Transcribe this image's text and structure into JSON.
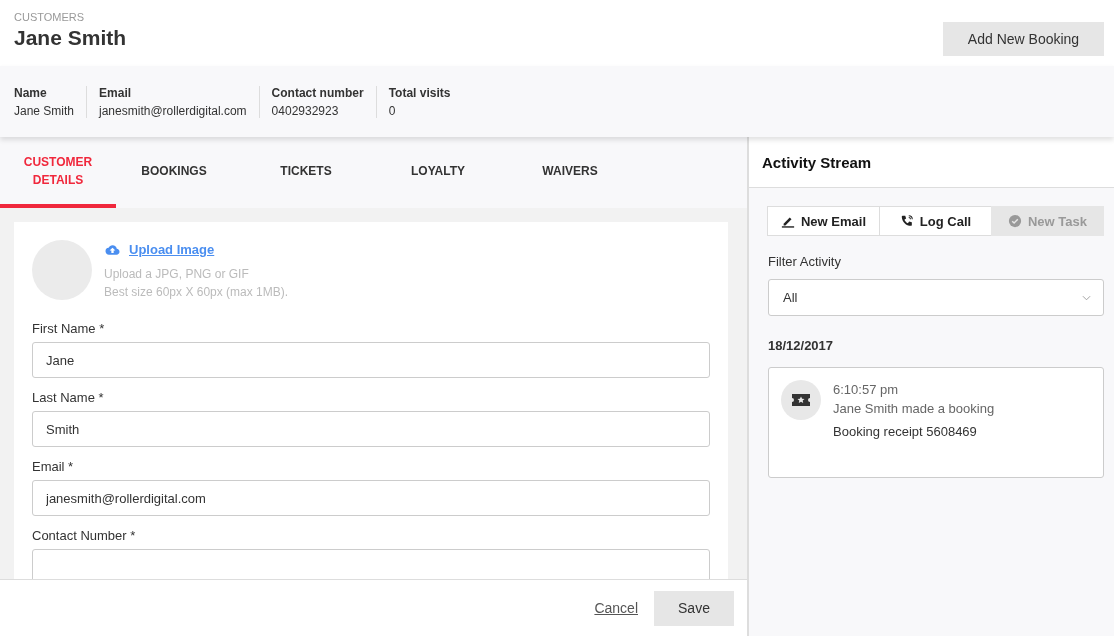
{
  "header": {
    "section": "CUSTOMERS",
    "title": "Jane Smith",
    "action": "Add New Booking"
  },
  "summary": [
    {
      "label": "Name",
      "value": "Jane Smith"
    },
    {
      "label": "Email",
      "value": "janesmith@rollerdigital.com"
    },
    {
      "label": "Contact number",
      "value": "0402932923"
    },
    {
      "label": "Total visits",
      "value": "0"
    }
  ],
  "tabs": [
    {
      "label": "CUSTOMER DETAILS",
      "selected": true
    },
    {
      "label": "BOOKINGS",
      "selected": false
    },
    {
      "label": "TICKETS",
      "selected": false
    },
    {
      "label": "LOYALTY",
      "selected": false
    },
    {
      "label": "WAIVERS",
      "selected": false
    }
  ],
  "upload": {
    "link": "Upload Image",
    "hint_1": "Upload a JPG, PNG or GIF",
    "hint_2": "Best size 60px X 60px (max 1MB)."
  },
  "fields": [
    {
      "label": "First Name *",
      "value": "Jane"
    },
    {
      "label": "Last Name *",
      "value": "Smith"
    },
    {
      "label": "Email *",
      "value": "janesmith@rollerdigital.com"
    },
    {
      "label": "Contact Number *"
    }
  ],
  "footer": {
    "cancel": "Cancel",
    "save": "Save"
  },
  "activity": {
    "title": "Activity Stream",
    "actions": [
      {
        "kind": "email",
        "label": "New Email",
        "disabled": false
      },
      {
        "kind": "call",
        "label": "Log Call",
        "disabled": false
      },
      {
        "kind": "task",
        "label": "New Task",
        "disabled": true
      }
    ],
    "filter_label": "Filter Activity",
    "filter_value": "All",
    "date": "18/12/2017",
    "entries": [
      {
        "time": "6:10:57 pm",
        "text": "Jane Smith made a booking",
        "detail": "Booking receipt 5608469"
      }
    ]
  }
}
